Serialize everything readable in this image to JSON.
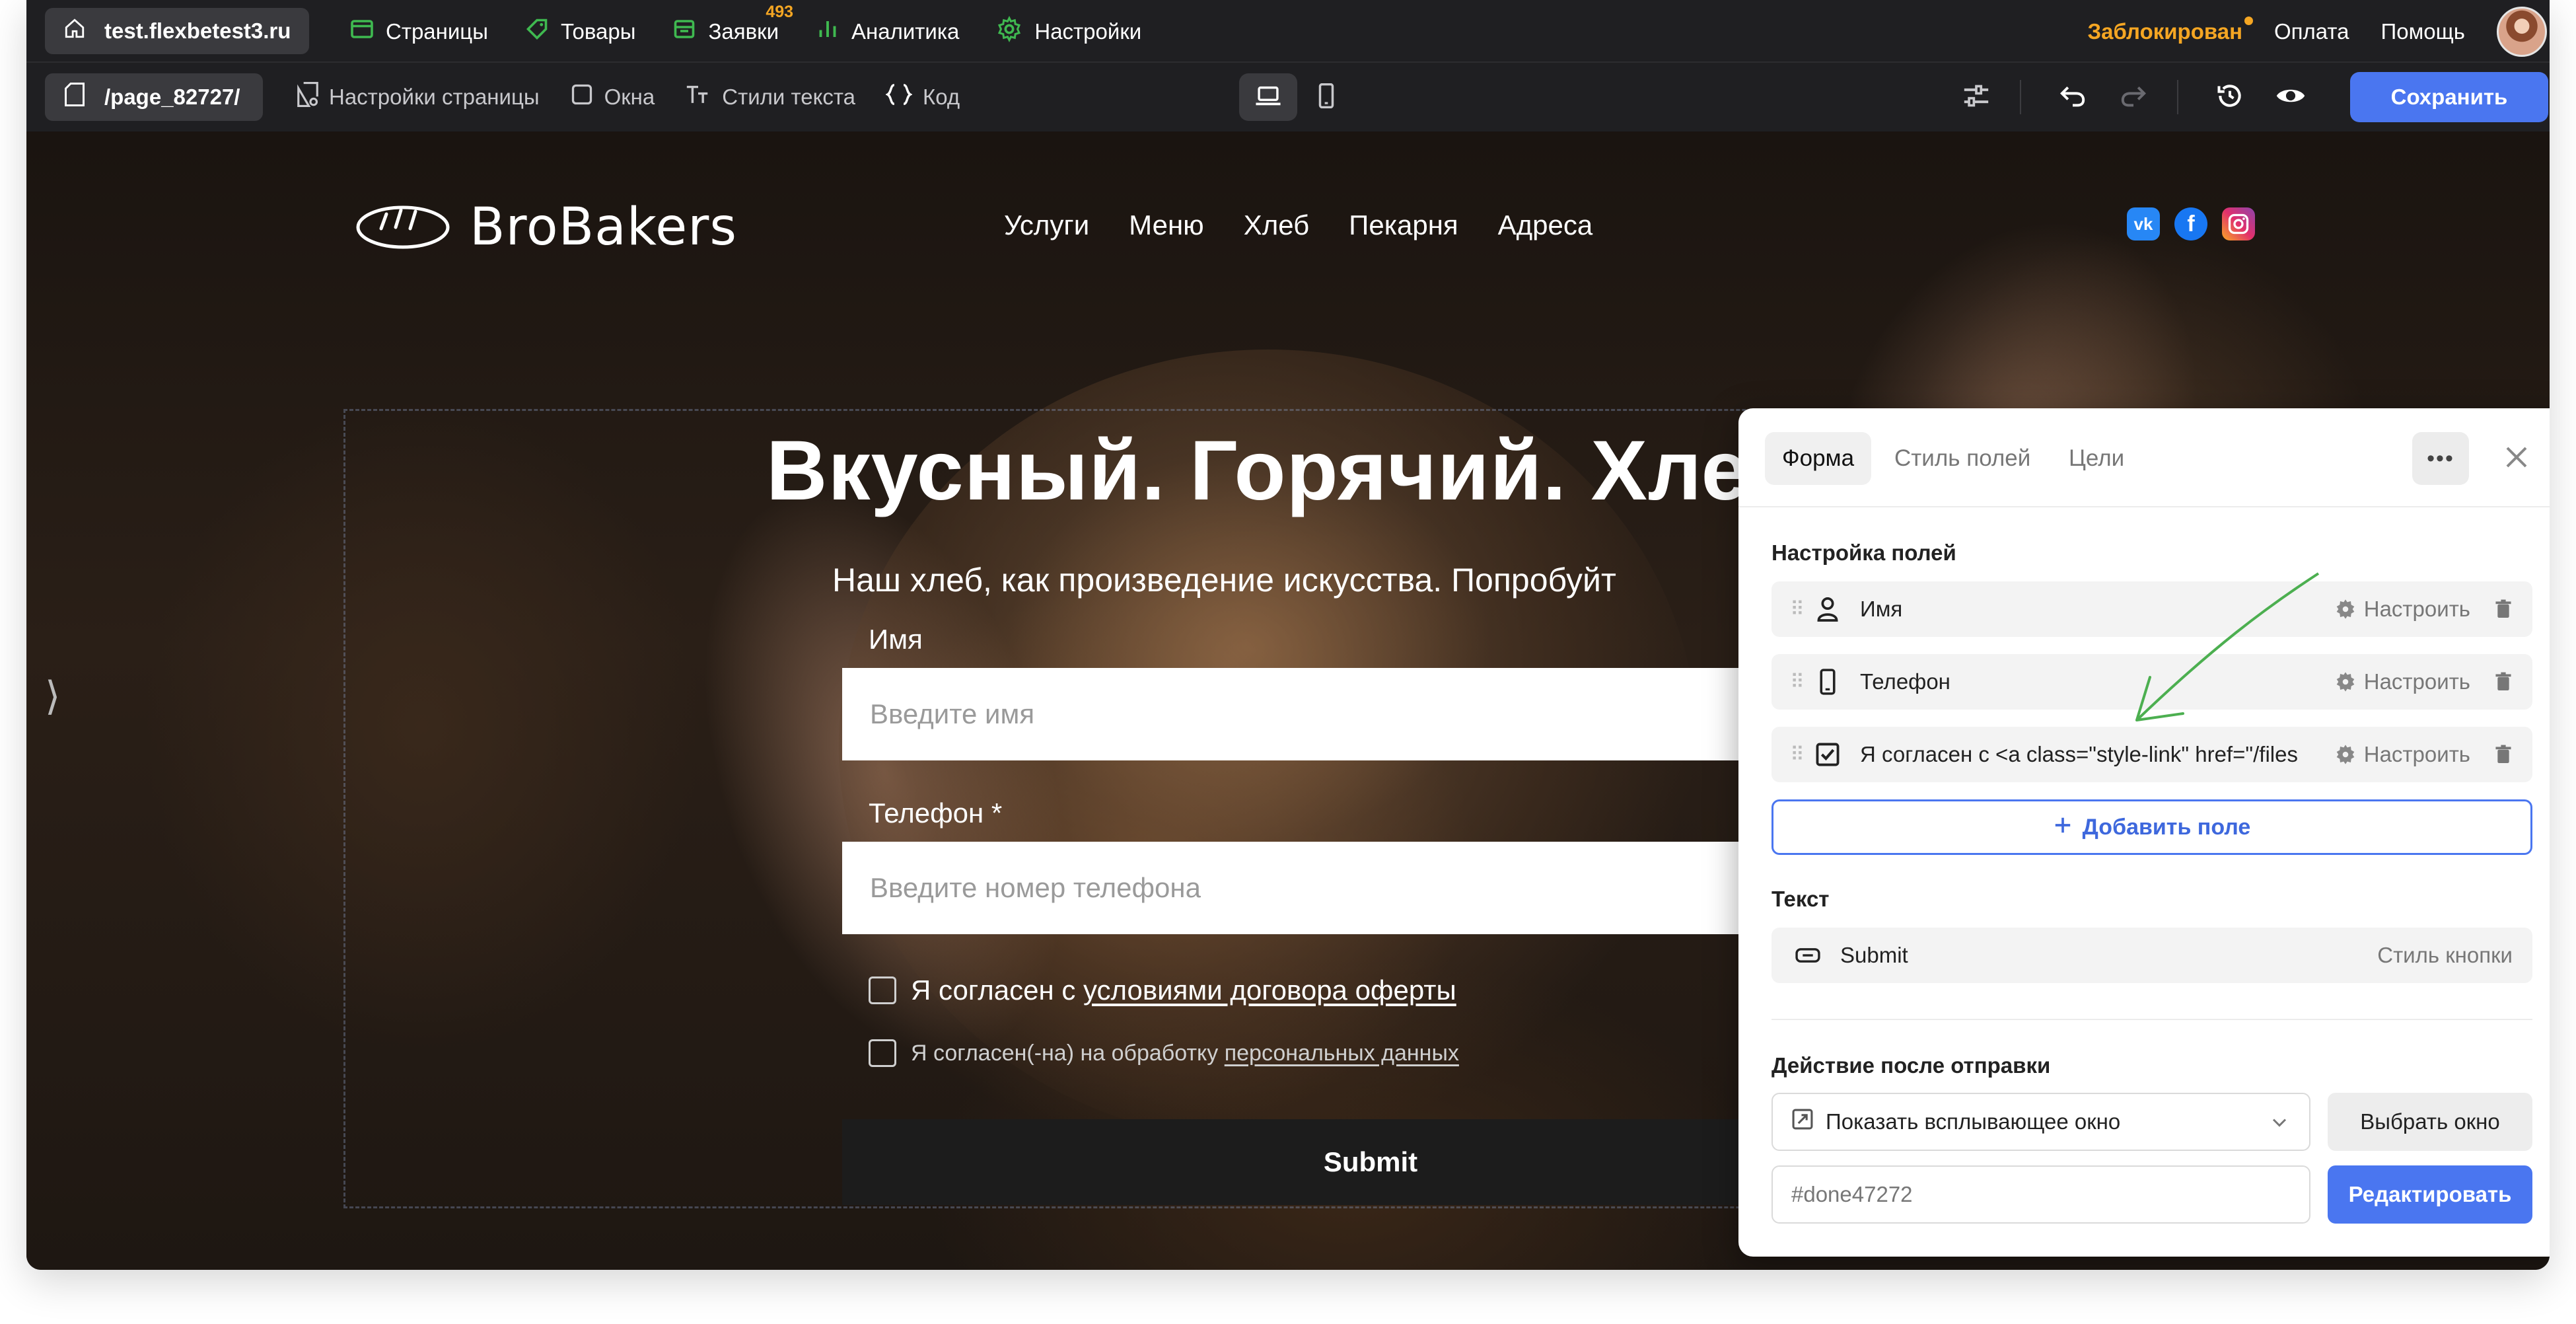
{
  "topbar": {
    "site": "test.flexbetest3.ru",
    "nav": [
      {
        "label": "Страницы",
        "icon": "browser-window-icon"
      },
      {
        "label": "Товары",
        "icon": "tag-icon"
      },
      {
        "label": "Заявки",
        "icon": "inbox-icon",
        "badge": "493"
      },
      {
        "label": "Аналитика",
        "icon": "bar-chart-icon"
      },
      {
        "label": "Настройки",
        "icon": "gear-icon"
      }
    ],
    "blocked": "Заблокирован",
    "payment": "Оплата",
    "help": "Помощь"
  },
  "toolbar": {
    "page": "/page_82727/",
    "items": [
      {
        "label": "Настройки страницы",
        "icon": "page-settings-icon"
      },
      {
        "label": "Окна",
        "icon": "window-icon"
      },
      {
        "label": "Стили текста",
        "icon": "text-style-icon"
      },
      {
        "label": "Код",
        "icon": "code-braces-icon"
      }
    ],
    "save": "Сохранить"
  },
  "site": {
    "logo": "BroBakers",
    "nav": [
      "Услуги",
      "Меню",
      "Хлеб",
      "Пекарня",
      "Адреса"
    ],
    "socials": [
      {
        "name": "vk",
        "label": "vk",
        "color": "#2787f5"
      },
      {
        "name": "facebook",
        "label": "f",
        "color": "#1877f2"
      },
      {
        "name": "instagram",
        "label": "",
        "color": "#e1306c"
      }
    ],
    "hero_title": "Вкусный. Горячий. Хле",
    "hero_sub": "Наш хлеб, как произведение искусства. Попробуйт",
    "form": {
      "name_label": "Имя",
      "name_placeholder": "Введите имя",
      "phone_label": "Телефон *",
      "phone_placeholder": "Введите номер телефона",
      "consent1_prefix": "Я согласен с ",
      "consent1_link": "условиями договора оферты",
      "consent2_prefix": "Я согласен(-на) на обработку ",
      "consent2_link": "персональных данных",
      "submit": "Submit"
    }
  },
  "panel": {
    "tabs": [
      "Форма",
      "Стиль полей",
      "Цели"
    ],
    "more": "•••",
    "fields_title": "Настройка полей",
    "fields": [
      {
        "name": "Имя",
        "icon": "user-icon"
      },
      {
        "name": "Телефон",
        "icon": "phone-icon"
      },
      {
        "name": "Я согласен с <a class=\"style-link\" href=\"/files",
        "icon": "checkbox-icon"
      }
    ],
    "configure": "Настроить",
    "add_field": "Добавить поле",
    "text_title": "Текст",
    "submit_name": "Submit",
    "button_style": "Стиль кнопки",
    "action_title": "Действие после отправки",
    "action_select": "Показать всплывающее окно",
    "choose_window": "Выбрать окно",
    "window_id": "#done47272",
    "edit": "Редактировать"
  },
  "colors": {
    "accent": "#4a76f0",
    "warning": "#f5a623",
    "nav_icon_green": "#3fb950",
    "annotation_arrow": "#4caf50"
  }
}
